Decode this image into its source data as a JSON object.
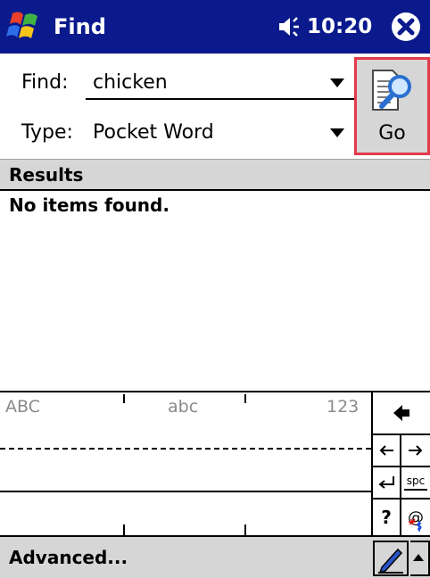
{
  "titlebar": {
    "app_title": "Find",
    "clock": "10:20",
    "start_icon": "windows-flag-icon",
    "volume_icon": "speaker-icon",
    "close_icon": "close-icon",
    "background_color": "#0a1a8c"
  },
  "find": {
    "label": "Find:",
    "value": "chicken"
  },
  "type": {
    "label": "Type:",
    "value": "Pocket Word"
  },
  "go_button": {
    "label": "Go",
    "icon": "document-magnifier-icon",
    "highlight_color": "#e43a49"
  },
  "results": {
    "header": "Results",
    "message": "No items found."
  },
  "input_panel": {
    "modes": [
      "ABC",
      "abc",
      "123"
    ],
    "keys": {
      "backspace": "backspace-icon",
      "left": "left-arrow-icon",
      "right": "right-arrow-icon",
      "enter": "enter-icon",
      "space": "spc",
      "question": "?",
      "symbols": "@"
    }
  },
  "bottombar": {
    "advanced_label": "Advanced...",
    "pen_icon": "pen-icon",
    "sip_icon": "up-arrow-icon"
  }
}
